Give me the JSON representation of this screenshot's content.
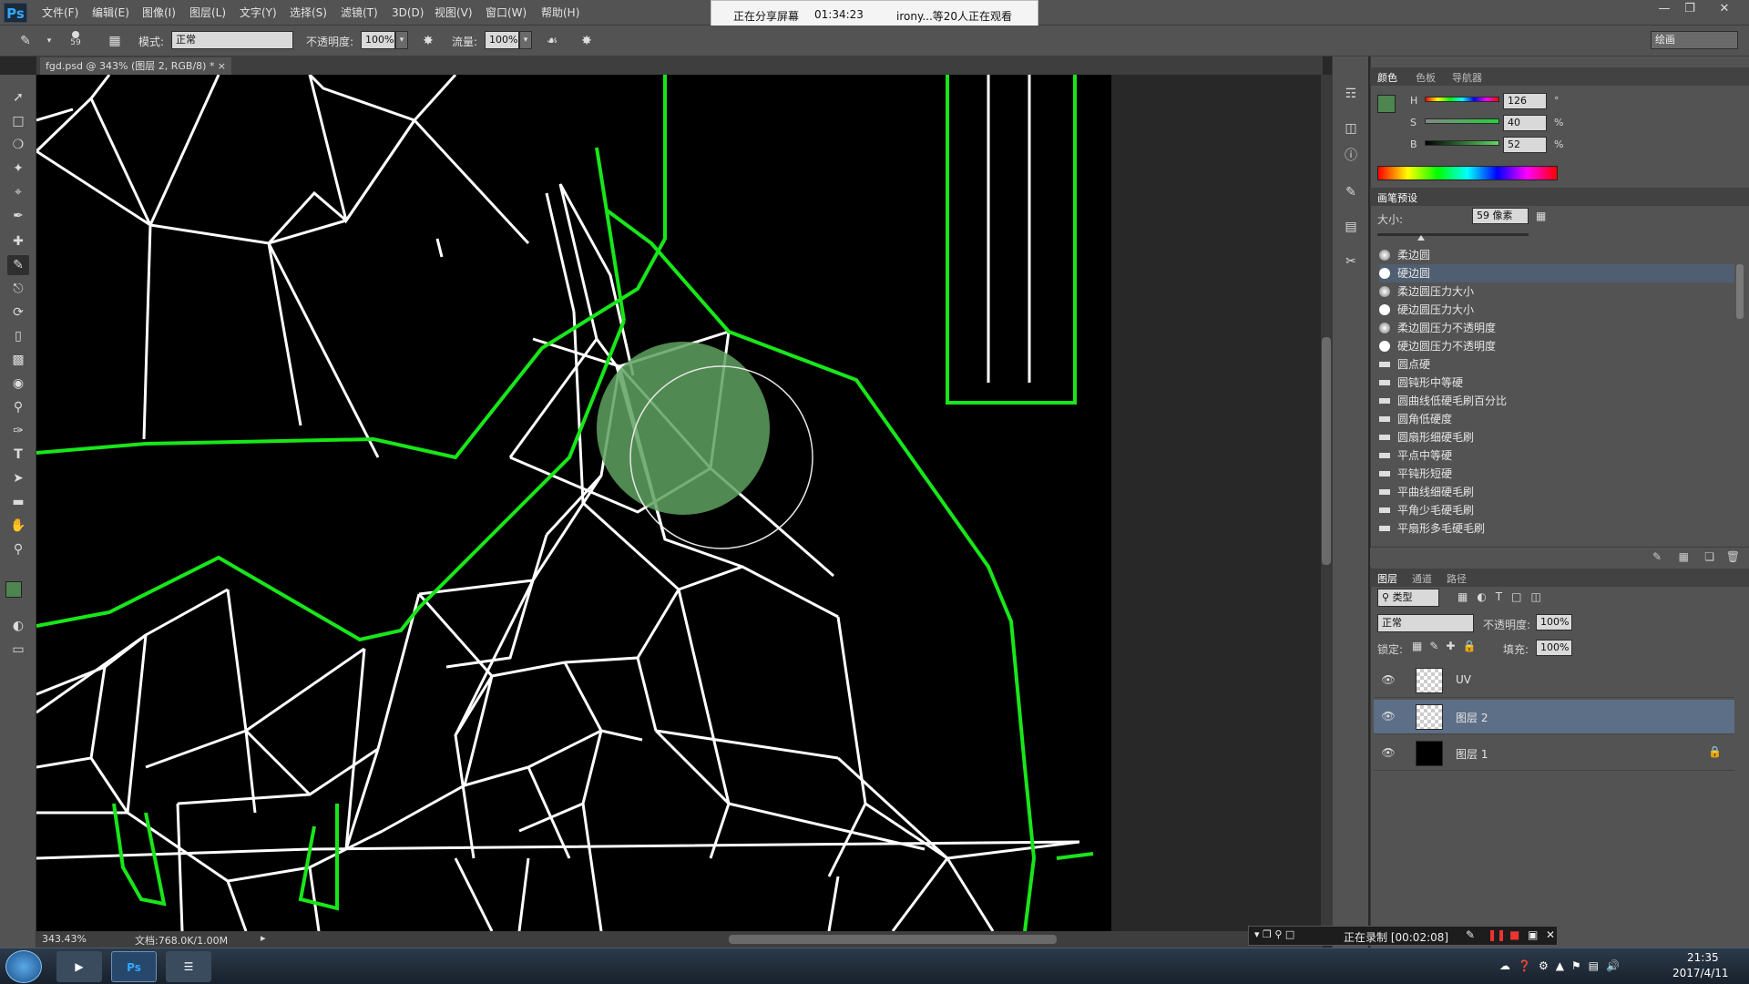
{
  "app": {
    "logo": "Ps"
  },
  "menubar": {
    "items": [
      "文件(F)",
      "编辑(E)",
      "图像(I)",
      "图层(L)",
      "文字(Y)",
      "选择(S)",
      "滤镜(T)",
      "3D(D)",
      "视图(V)",
      "窗口(W)",
      "帮助(H)"
    ]
  },
  "share_banner": {
    "status": "正在分享屏幕",
    "time": "01:34:23",
    "viewers": "irony...等20人正在观看"
  },
  "options": {
    "brush_size": "59",
    "mode_label": "模式:",
    "mode_value": "正常",
    "opacity_label": "不透明度:",
    "opacity_value": "100%",
    "flow_label": "流量:",
    "flow_value": "100%",
    "workspace": "绘画"
  },
  "document": {
    "tab_title": "fgd.psd @ 343% (图层 2, RGB/8) *",
    "zoom": "343.43%",
    "doc_size": "文档:768.0K/1.00M"
  },
  "color_panel": {
    "tabs": [
      "颜色",
      "色板",
      "导航器"
    ],
    "h_label": "H",
    "h_value": "126",
    "h_unit": "°",
    "s_label": "S",
    "s_value": "40",
    "s_unit": "%",
    "b_label": "B",
    "b_value": "52",
    "b_unit": "%",
    "foreground": "#4f8550",
    "background": "#ffffff"
  },
  "brush_preset_panel": {
    "title": "画笔预设",
    "size_label": "大小:",
    "size_value": "59 像素",
    "presets": [
      "柔边圆",
      "硬边圆",
      "柔边圆压力大小",
      "硬边圆压力大小",
      "柔边圆压力不透明度",
      "硬边圆压力不透明度",
      "圆点硬",
      "圆钝形中等硬",
      "圆曲线低硬毛刷百分比",
      "圆角低硬度",
      "圆扇形细硬毛刷",
      "平点中等硬",
      "平钝形短硬",
      "平曲线细硬毛刷",
      "平角少毛硬毛刷",
      "平扇形多毛硬毛刷"
    ],
    "selected_index": 1
  },
  "layers_panel": {
    "tabs": [
      "图层",
      "通道",
      "路径"
    ],
    "filter_label": "类型",
    "blend_mode": "正常",
    "opacity_label": "不透明度:",
    "opacity_value": "100%",
    "lock_label": "锁定:",
    "fill_label": "填充:",
    "fill_value": "100%",
    "layers": [
      {
        "name": "UV",
        "thumb": "checker"
      },
      {
        "name": "图层 2",
        "thumb": "checker"
      },
      {
        "name": "图层 1",
        "thumb": "black"
      }
    ],
    "selected_index": 1
  },
  "recording_bar": {
    "text": "正在录制 [00:02:08]"
  },
  "taskbar": {
    "time": "21:35",
    "date": "2017/4/11"
  }
}
